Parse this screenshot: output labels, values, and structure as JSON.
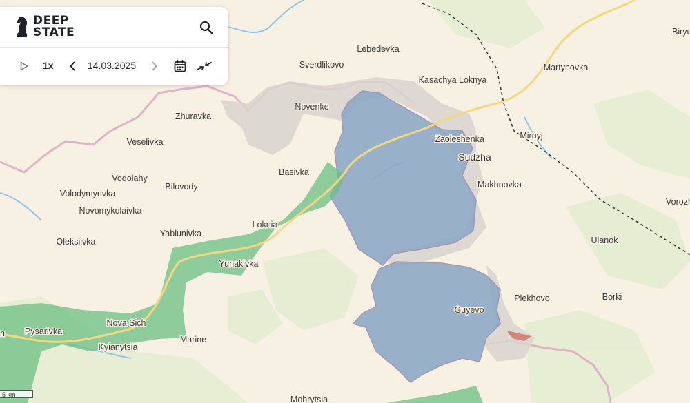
{
  "brand": {
    "line1": "DEEP",
    "line2": "STATE",
    "logo_icon": "knight-chess-icon"
  },
  "controls": {
    "play_icon": "play-icon",
    "speed": "1x",
    "prev_icon": "chevron-left-icon",
    "date": "14.03.2025",
    "next_icon": "chevron-right-icon",
    "calendar_icon": "calendar-icon",
    "compare_icon": "collapse-arrows-icon",
    "search_icon": "search-icon"
  },
  "map": {
    "colors": {
      "background": "#f7f1e3",
      "forest": "#e6edd2",
      "occupied_zone": "#8fa9c7",
      "grey_zone": "#d8d3ce",
      "green_zone": "#6cbf84",
      "red_zone": "#d9766a",
      "road": "#f5d77c",
      "border_pink": "#dca8c6",
      "water": "#8fc6e8"
    },
    "labels": {
      "lebedevka": "Lebedevka",
      "sverdlikovo": "Sverdlikovo",
      "kasachya_loknya": "Kasachya Loknya",
      "martynovka": "Martynovka",
      "biryu": "Biryu",
      "novenke": "Novenke",
      "zhuravka": "Zhuravka",
      "veselivka": "Veselivka",
      "zaoleshenka": "Zaoleshenka",
      "mirnyj": "Mirnyj",
      "sudzha": "Sudzha",
      "basivka": "Basivka",
      "vodolahy": "Vodolahy",
      "bilovody": "Bilovody",
      "volodymyrivka": "Volodymyrivka",
      "makhnovka": "Makhnovka",
      "novomykolaivka": "Novomykolaivka",
      "vorozh": "Vorozh",
      "loknia": "Loknia",
      "yablunivka": "Yablunivka",
      "oleksiivka": "Oleksiivka",
      "ulanok": "Ulanok",
      "yunakivka": "Yunakivka",
      "plekhovo": "Plekhovo",
      "borki": "Borki",
      "guyevo": "Guyevo",
      "nova_sich": "Nova Sich",
      "pysarivka": "Pysarivka",
      "kyianytsia": "Kyianytsia",
      "marine": "Marine",
      "mohrytsia": "Mohrytsia",
      "edge_n": "n"
    },
    "scale": "5 km"
  }
}
